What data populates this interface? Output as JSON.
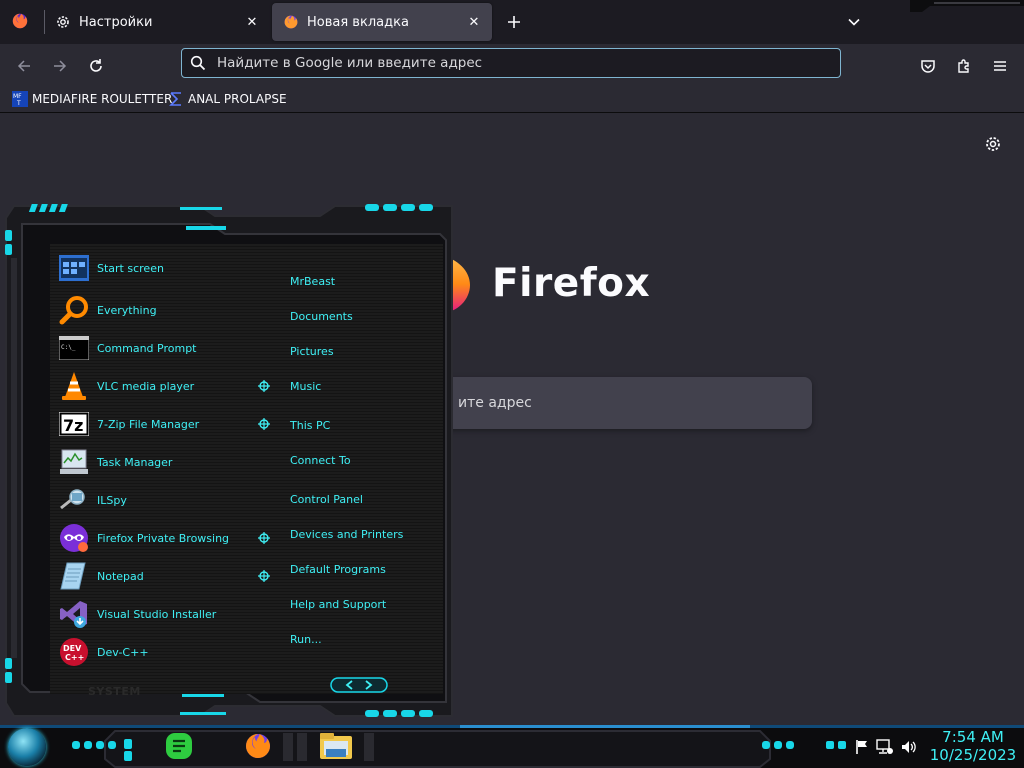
{
  "tabs": [
    {
      "title": "Настройки",
      "icon": "gear-icon"
    },
    {
      "title": "Новая вкладка",
      "icon": "firefox-icon",
      "active": true
    }
  ],
  "urlbar": {
    "placeholder": "Найдите в Google или введите адрес"
  },
  "bookmarks": [
    {
      "label": "MEDIAFIRE ROULETTER",
      "icon": "mediafire-icon"
    },
    {
      "label": "ANAL PROLAPSE",
      "icon": "sigma-icon"
    }
  ],
  "newtab": {
    "brand": "Firefox",
    "search_placeholder_visible": "ите адрес"
  },
  "start_menu": {
    "programs": [
      {
        "label": "Start screen",
        "icon": "start-screen-icon",
        "pinned": false
      },
      {
        "label": "Everything",
        "icon": "magnifier-icon",
        "pinned": false
      },
      {
        "label": "Command Prompt",
        "icon": "cmd-icon",
        "pinned": false
      },
      {
        "label": "VLC media player",
        "icon": "vlc-cone-icon",
        "pinned": true
      },
      {
        "label": "7-Zip File Manager",
        "icon": "7zip-icon",
        "pinned": true
      },
      {
        "label": "Task Manager",
        "icon": "task-manager-icon",
        "pinned": false
      },
      {
        "label": "ILSpy",
        "icon": "ilspy-icon",
        "pinned": false
      },
      {
        "label": "Firefox Private Browsing",
        "icon": "private-browsing-icon",
        "pinned": true
      },
      {
        "label": "Notepad",
        "icon": "notepad-icon",
        "pinned": true
      },
      {
        "label": "Visual Studio Installer",
        "icon": "vs-installer-icon",
        "pinned": false
      },
      {
        "label": "Dev-C++",
        "icon": "devcpp-icon",
        "pinned": false
      }
    ],
    "links": [
      "MrBeast",
      "Documents",
      "Pictures",
      "Music",
      "This PC",
      "Connect To",
      "Control Panel",
      "Devices and Printers",
      "Default Programs",
      "Help and Support",
      "Run..."
    ],
    "system_label": "SYSTEM",
    "accent": "#3ff0f5"
  },
  "taskbar": {
    "apps": [
      "notes-app-icon",
      "firefox-icon",
      "file-explorer-icon"
    ],
    "tray": [
      "flag-icon",
      "network-icon",
      "volume-icon"
    ],
    "clock": {
      "time": "7:54 AM",
      "date": "10/25/2023"
    }
  }
}
